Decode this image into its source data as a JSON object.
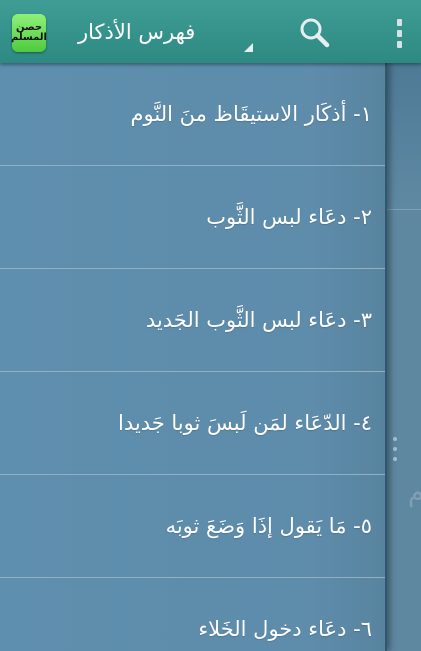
{
  "app": {
    "logo_line1": "حصن",
    "logo_line2": "المسلم",
    "title": "فهرس الأذكار"
  },
  "icons": {
    "search": "search-icon",
    "overflow": "overflow-menu-icon",
    "dropdown": "dropdown-indicator-icon"
  },
  "colors": {
    "actionbar": "#2f8f87",
    "drawer": "#5e8cab",
    "logo": "#6fe05c"
  },
  "drawer": {
    "items": [
      {
        "label": "١- أذكَار الاستيقَاظ منَ النَّوم"
      },
      {
        "label": "٢- دعَاء لبس الثَّوب"
      },
      {
        "label": "٣- دعَاء لبس الثَّوب الجَديد"
      },
      {
        "label": "٤- الدّعَاء لمَن لَبسَ ثوبا جَديدا"
      },
      {
        "label": "٥- مَا يَقول إذَا وَضَعَ ثوبَه"
      },
      {
        "label": "٦- دعَاء دخول الخَلاء"
      }
    ]
  }
}
